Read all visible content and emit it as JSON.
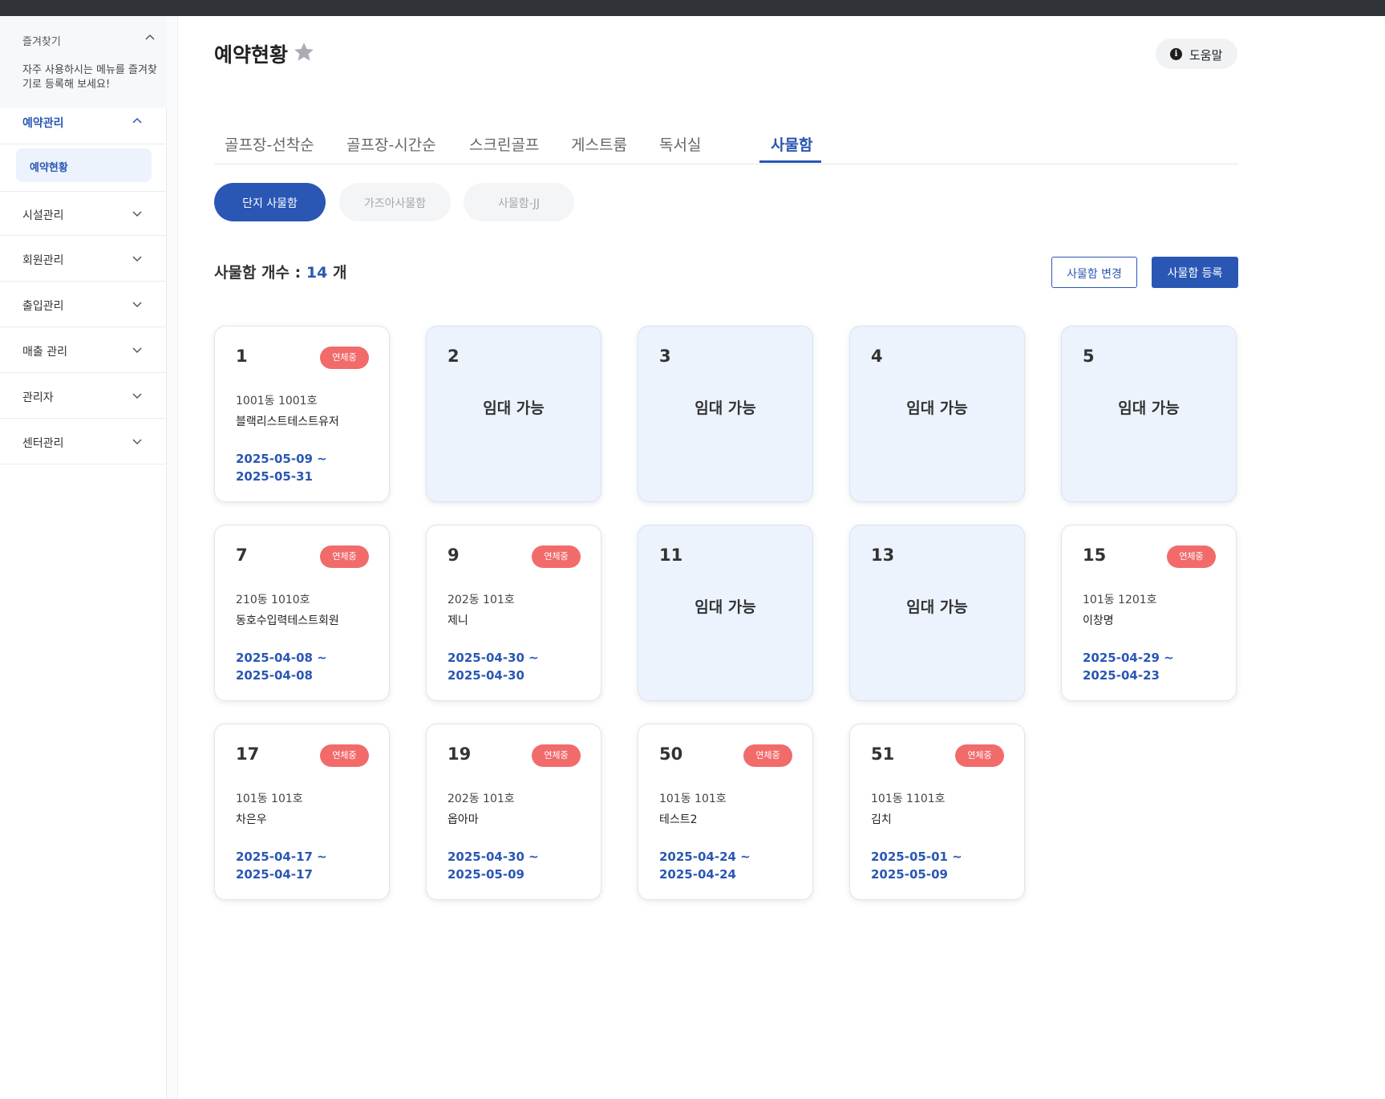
{
  "sidebar": {
    "favorites": {
      "title": "즐겨찾기",
      "description": "자주 사용하시는 메뉴를 즐겨찾기로 등록해 보세요!"
    },
    "sections": [
      {
        "label": "예약관리",
        "expanded": true,
        "sub_items": [
          {
            "label": "예약현황",
            "active": true
          }
        ]
      },
      {
        "label": "시설관리",
        "expanded": false
      },
      {
        "label": "회원관리",
        "expanded": false
      },
      {
        "label": "출입관리",
        "expanded": false
      },
      {
        "label": "매출 관리",
        "expanded": false
      },
      {
        "label": "관리자",
        "expanded": false
      },
      {
        "label": "센터관리",
        "expanded": false
      }
    ]
  },
  "header": {
    "title": "예약현황",
    "help_label": "도움말",
    "help_icon": "i"
  },
  "tabs": [
    {
      "label": "골프장-선착순",
      "active": false
    },
    {
      "label": "골프장-시간순",
      "active": false
    },
    {
      "label": "스크린골프",
      "active": false
    },
    {
      "label": "게스트룸",
      "active": false
    },
    {
      "label": "독서실",
      "active": false
    },
    {
      "label": "사물함",
      "active": true
    }
  ],
  "locker_groups": [
    {
      "label": "단지 사물함",
      "active": true
    },
    {
      "label": "가즈아사물함",
      "active": false
    },
    {
      "label": "사물함-JJ",
      "active": false
    }
  ],
  "summary": {
    "prefix": "사물함 개수 :",
    "count": "14",
    "suffix": "개"
  },
  "actions": {
    "edit_label": "사물함 변경",
    "register_label": "사물함 등록"
  },
  "colors": {
    "primary": "#2a57b4",
    "overdue_badge": "#f26b6b",
    "available_card": "#ecf3fd"
  },
  "lockers": [
    {
      "number": "1",
      "status": "overdue",
      "badge": "연체중",
      "unit": "1001동 1001호",
      "name": "블랙리스트테스트유저",
      "start": "2025-05-09 ~",
      "end": "2025-05-31"
    },
    {
      "number": "2",
      "status": "available",
      "available_label": "임대 가능"
    },
    {
      "number": "3",
      "status": "available",
      "available_label": "임대 가능"
    },
    {
      "number": "4",
      "status": "available",
      "available_label": "임대 가능"
    },
    {
      "number": "5",
      "status": "available",
      "available_label": "임대 가능"
    },
    {
      "number": "7",
      "status": "overdue",
      "badge": "연체중",
      "unit": "210동 1010호",
      "name": "동호수입력테스트회원",
      "start": "2025-04-08 ~",
      "end": "2025-04-08"
    },
    {
      "number": "9",
      "status": "overdue",
      "badge": "연체중",
      "unit": "202동 101호",
      "name": "제니",
      "start": "2025-04-30 ~",
      "end": "2025-04-30"
    },
    {
      "number": "11",
      "status": "available",
      "available_label": "임대 가능"
    },
    {
      "number": "13",
      "status": "available",
      "available_label": "임대 가능"
    },
    {
      "number": "15",
      "status": "overdue",
      "badge": "연체중",
      "unit": "101동 1201호",
      "name": "이창명",
      "start": "2025-04-29 ~",
      "end": "2025-04-23"
    },
    {
      "number": "17",
      "status": "overdue",
      "badge": "연체중",
      "unit": "101동 101호",
      "name": "차은우",
      "start": "2025-04-17 ~",
      "end": "2025-04-17"
    },
    {
      "number": "19",
      "status": "overdue",
      "badge": "연체중",
      "unit": "202동 101호",
      "name": "옵아마",
      "start": "2025-04-30 ~",
      "end": "2025-05-09"
    },
    {
      "number": "50",
      "status": "overdue",
      "badge": "연체중",
      "unit": "101동 101호",
      "name": "테스트2",
      "start": "2025-04-24 ~",
      "end": "2025-04-24"
    },
    {
      "number": "51",
      "status": "overdue",
      "badge": "연체중",
      "unit": "101동 1101호",
      "name": "김치",
      "start": "2025-05-01 ~",
      "end": "2025-05-09"
    }
  ]
}
